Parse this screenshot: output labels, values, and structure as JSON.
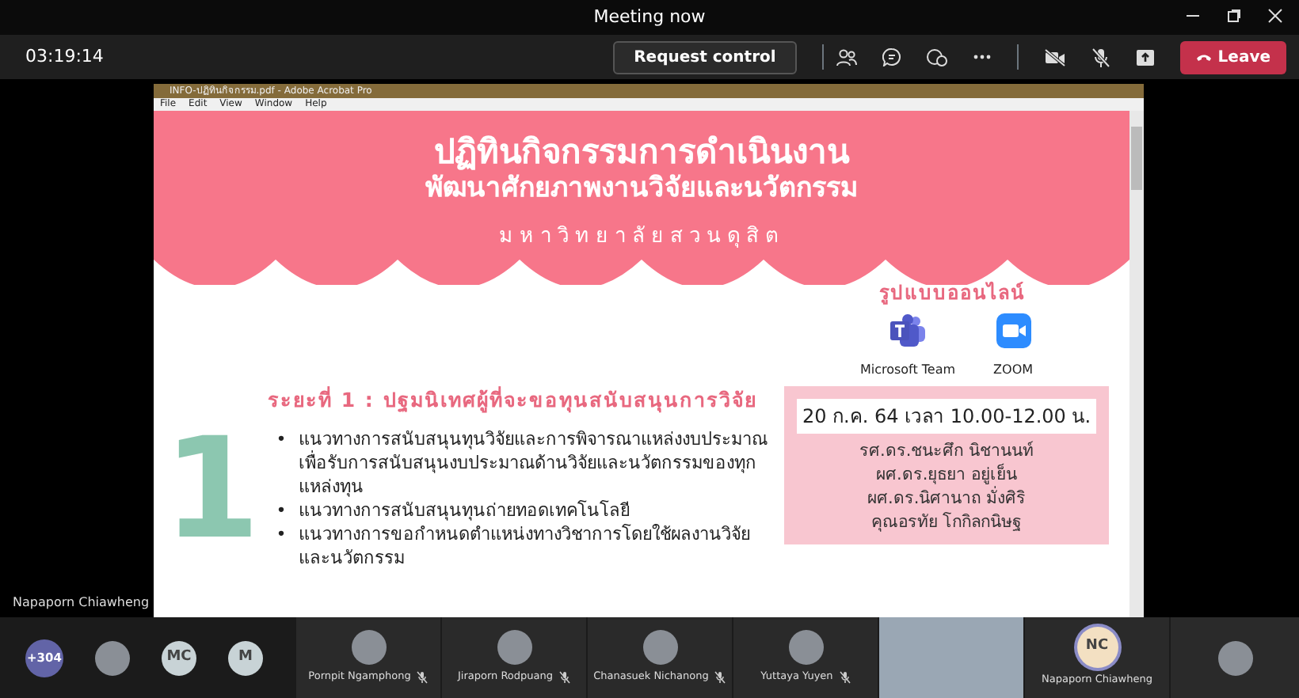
{
  "window": {
    "title": "Meeting now"
  },
  "toolbar": {
    "timer": "03:19:14",
    "request_control": "Request control",
    "camera_on": false,
    "mic_on": false,
    "leave": "Leave"
  },
  "shared_screen": {
    "presenter": "Napaporn Chiawheng",
    "app_title": "INFO-ปฏิทินกิจกรรม.pdf - Adobe Acrobat Pro",
    "menu": [
      "File",
      "Edit",
      "View",
      "Window",
      "Help"
    ],
    "document": {
      "title_lines": [
        "ปฏิทินกิจกรรมการดำเนินงาน",
        "พัฒนาศักยภาพงานวิจัยและนวัตกรรม"
      ],
      "subtitle": "มหาวิทยาลัยสวนดุสิต",
      "online_heading": "รูปแบบออนไลน์",
      "platforms": [
        {
          "kind": "teams",
          "label": "Microsoft Team"
        },
        {
          "kind": "zoom",
          "label": "ZOOM"
        }
      ],
      "phase_heading": "ระยะที่ 1 : ปฐมนิเทศผู้ที่จะขอทุนสนับสนุนการวิจัย",
      "phase_number": "1",
      "bullet_marker": "•",
      "bullets": [
        "แนวทางการสนับสนุนทุนวิจัยและการพิจารณาแหล่งงบประมาณเพื่อรับการสนับสนุนงบประมาณด้านวิจัยและนวัตกรรมของทุกแหล่งทุน",
        "แนวทางการสนับสนุนทุนถ่ายทอดเทคโนโลยี",
        "แนวทางการขอกำหนดตำแหน่งทางวิชาการโดยใช้ผลงานวิจัยและนวัตกรรม"
      ],
      "schedule": {
        "date": "20 ก.ค. 64  เวลา 10.00-12.00 น.",
        "speakers": [
          "รศ.ดร.ชนะศึก นิชานนท์",
          "ผศ.ดร.ยุธยา อยู่เย็น",
          "ผศ.ดร.นิศานาถ มั่งศิริ",
          "คุณอรทัย โกกิลกนิษฐ"
        ]
      }
    }
  },
  "participants": {
    "overflow": "+304",
    "avatars": [
      {
        "kind": "photo"
      },
      {
        "kind": "initials",
        "initials": "MC"
      },
      {
        "kind": "initials",
        "initials": "M"
      }
    ],
    "tiles": [
      {
        "kind": "photo",
        "name": "Pornpit Ngamphong",
        "muted": true
      },
      {
        "kind": "photo",
        "name": "Jiraporn Rodpuang",
        "muted": true
      },
      {
        "kind": "photo",
        "name": "Chanasuek Nichanong",
        "muted": true
      },
      {
        "kind": "photo",
        "name": "Yuttaya Yuyen",
        "muted": true
      },
      {
        "kind": "video"
      },
      {
        "kind": "initials",
        "initials": "NC",
        "name": "Napaporn Chiawheng",
        "speaking": true
      },
      {
        "kind": "photo"
      }
    ]
  }
}
